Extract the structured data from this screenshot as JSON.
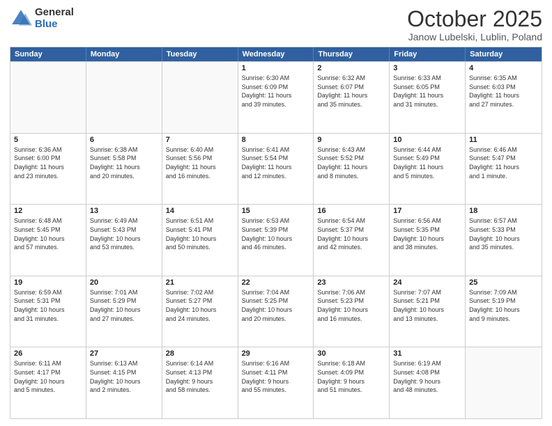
{
  "logo": {
    "general": "General",
    "blue": "Blue"
  },
  "header": {
    "month": "October 2025",
    "location": "Janow Lubelski, Lublin, Poland"
  },
  "weekdays": [
    "Sunday",
    "Monday",
    "Tuesday",
    "Wednesday",
    "Thursday",
    "Friday",
    "Saturday"
  ],
  "rows": [
    [
      {
        "day": "",
        "text": ""
      },
      {
        "day": "",
        "text": ""
      },
      {
        "day": "",
        "text": ""
      },
      {
        "day": "1",
        "text": "Sunrise: 6:30 AM\nSunset: 6:09 PM\nDaylight: 11 hours\nand 39 minutes."
      },
      {
        "day": "2",
        "text": "Sunrise: 6:32 AM\nSunset: 6:07 PM\nDaylight: 11 hours\nand 35 minutes."
      },
      {
        "day": "3",
        "text": "Sunrise: 6:33 AM\nSunset: 6:05 PM\nDaylight: 11 hours\nand 31 minutes."
      },
      {
        "day": "4",
        "text": "Sunrise: 6:35 AM\nSunset: 6:03 PM\nDaylight: 11 hours\nand 27 minutes."
      }
    ],
    [
      {
        "day": "5",
        "text": "Sunrise: 6:36 AM\nSunset: 6:00 PM\nDaylight: 11 hours\nand 23 minutes."
      },
      {
        "day": "6",
        "text": "Sunrise: 6:38 AM\nSunset: 5:58 PM\nDaylight: 11 hours\nand 20 minutes."
      },
      {
        "day": "7",
        "text": "Sunrise: 6:40 AM\nSunset: 5:56 PM\nDaylight: 11 hours\nand 16 minutes."
      },
      {
        "day": "8",
        "text": "Sunrise: 6:41 AM\nSunset: 5:54 PM\nDaylight: 11 hours\nand 12 minutes."
      },
      {
        "day": "9",
        "text": "Sunrise: 6:43 AM\nSunset: 5:52 PM\nDaylight: 11 hours\nand 8 minutes."
      },
      {
        "day": "10",
        "text": "Sunrise: 6:44 AM\nSunset: 5:49 PM\nDaylight: 11 hours\nand 5 minutes."
      },
      {
        "day": "11",
        "text": "Sunrise: 6:46 AM\nSunset: 5:47 PM\nDaylight: 11 hours\nand 1 minute."
      }
    ],
    [
      {
        "day": "12",
        "text": "Sunrise: 6:48 AM\nSunset: 5:45 PM\nDaylight: 10 hours\nand 57 minutes."
      },
      {
        "day": "13",
        "text": "Sunrise: 6:49 AM\nSunset: 5:43 PM\nDaylight: 10 hours\nand 53 minutes."
      },
      {
        "day": "14",
        "text": "Sunrise: 6:51 AM\nSunset: 5:41 PM\nDaylight: 10 hours\nand 50 minutes."
      },
      {
        "day": "15",
        "text": "Sunrise: 6:53 AM\nSunset: 5:39 PM\nDaylight: 10 hours\nand 46 minutes."
      },
      {
        "day": "16",
        "text": "Sunrise: 6:54 AM\nSunset: 5:37 PM\nDaylight: 10 hours\nand 42 minutes."
      },
      {
        "day": "17",
        "text": "Sunrise: 6:56 AM\nSunset: 5:35 PM\nDaylight: 10 hours\nand 38 minutes."
      },
      {
        "day": "18",
        "text": "Sunrise: 6:57 AM\nSunset: 5:33 PM\nDaylight: 10 hours\nand 35 minutes."
      }
    ],
    [
      {
        "day": "19",
        "text": "Sunrise: 6:59 AM\nSunset: 5:31 PM\nDaylight: 10 hours\nand 31 minutes."
      },
      {
        "day": "20",
        "text": "Sunrise: 7:01 AM\nSunset: 5:29 PM\nDaylight: 10 hours\nand 27 minutes."
      },
      {
        "day": "21",
        "text": "Sunrise: 7:02 AM\nSunset: 5:27 PM\nDaylight: 10 hours\nand 24 minutes."
      },
      {
        "day": "22",
        "text": "Sunrise: 7:04 AM\nSunset: 5:25 PM\nDaylight: 10 hours\nand 20 minutes."
      },
      {
        "day": "23",
        "text": "Sunrise: 7:06 AM\nSunset: 5:23 PM\nDaylight: 10 hours\nand 16 minutes."
      },
      {
        "day": "24",
        "text": "Sunrise: 7:07 AM\nSunset: 5:21 PM\nDaylight: 10 hours\nand 13 minutes."
      },
      {
        "day": "25",
        "text": "Sunrise: 7:09 AM\nSunset: 5:19 PM\nDaylight: 10 hours\nand 9 minutes."
      }
    ],
    [
      {
        "day": "26",
        "text": "Sunrise: 6:11 AM\nSunset: 4:17 PM\nDaylight: 10 hours\nand 5 minutes."
      },
      {
        "day": "27",
        "text": "Sunrise: 6:13 AM\nSunset: 4:15 PM\nDaylight: 10 hours\nand 2 minutes."
      },
      {
        "day": "28",
        "text": "Sunrise: 6:14 AM\nSunset: 4:13 PM\nDaylight: 9 hours\nand 58 minutes."
      },
      {
        "day": "29",
        "text": "Sunrise: 6:16 AM\nSunset: 4:11 PM\nDaylight: 9 hours\nand 55 minutes."
      },
      {
        "day": "30",
        "text": "Sunrise: 6:18 AM\nSunset: 4:09 PM\nDaylight: 9 hours\nand 51 minutes."
      },
      {
        "day": "31",
        "text": "Sunrise: 6:19 AM\nSunset: 4:08 PM\nDaylight: 9 hours\nand 48 minutes."
      },
      {
        "day": "",
        "text": ""
      }
    ]
  ]
}
